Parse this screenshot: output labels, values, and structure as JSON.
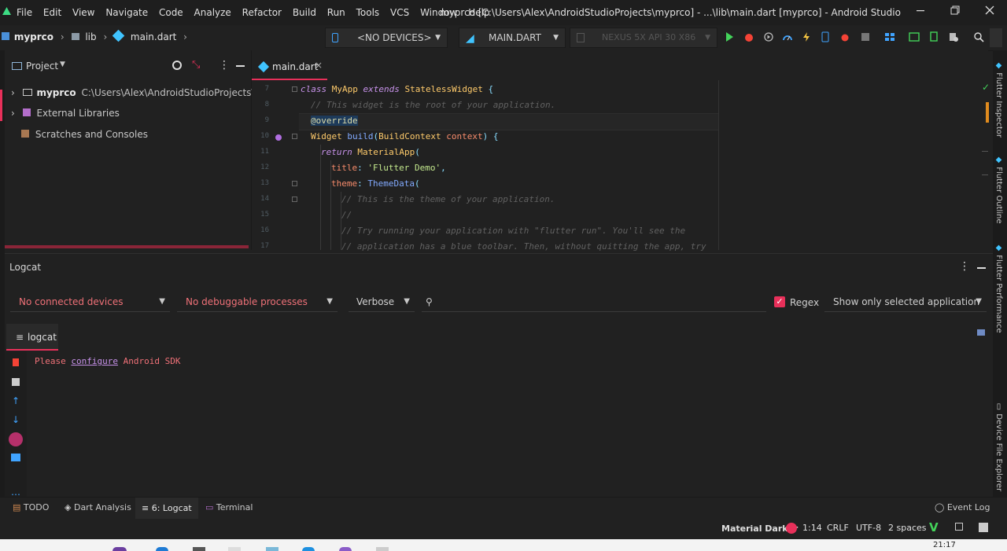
{
  "menu": [
    "File",
    "Edit",
    "View",
    "Navigate",
    "Code",
    "Analyze",
    "Refactor",
    "Build",
    "Run",
    "Tools",
    "VCS",
    "Window",
    "Help"
  ],
  "window_title": "myprco [C:\\Users\\Alex\\AndroidStudioProjects\\myprco] - ...\\lib\\main.dart [myprco] - Android Studio",
  "breadcrumb": {
    "project": "myprco",
    "folder": "lib",
    "file": "main.dart"
  },
  "toolbar": {
    "devices": "<NO DEVICES>",
    "run_config": "MAIN.DART",
    "emulator": "NEXUS 5X API 30 X86"
  },
  "project_panel": {
    "title": "Project",
    "root_name": "myprco",
    "root_path": "C:\\Users\\Alex\\AndroidStudioProjects\\myprco",
    "items": [
      "External Libraries",
      "Scratches and Consoles"
    ]
  },
  "editor": {
    "tab": "main.dart",
    "lines": [
      {
        "n": "7"
      },
      {
        "n": "8"
      },
      {
        "n": "9"
      },
      {
        "n": "10"
      },
      {
        "n": "11"
      },
      {
        "n": "12"
      },
      {
        "n": "13"
      },
      {
        "n": "14"
      },
      {
        "n": "15"
      },
      {
        "n": "16"
      },
      {
        "n": "17"
      }
    ],
    "code": {
      "l7a": "class",
      "l7b": "MyApp",
      "l7c": "extends",
      "l7d": "StatelessWidget",
      "l7e": "{",
      "l8": "// This widget is the root of your application.",
      "l9": "@override",
      "l10a": "Widget",
      "l10b": "build",
      "l10c": "(",
      "l10d": "BuildContext",
      "l10e": "context",
      "l10f": ") {",
      "l11a": "return",
      "l11b": "MaterialApp",
      "l11c": "(",
      "l12a": "title",
      "l12b": ":",
      "l12c": "'Flutter Demo'",
      "l12d": ",",
      "l13a": "theme",
      "l13b": ":",
      "l13c": "ThemeData",
      "l13d": "(",
      "l14": "// This is the theme of your application.",
      "l15": "//",
      "l16": "// Try running your application with \"flutter run\". You'll see the",
      "l17": "// application has a blue toolbar. Then, without quitting the app, try"
    }
  },
  "logcat": {
    "title": "Logcat",
    "device": "No connected devices",
    "process": "No debuggable processes",
    "level": "Verbose",
    "search_placeholder": "",
    "regex": "Regex",
    "filter": "Show only selected application",
    "tab": "logcat",
    "msg_a": "Please",
    "msg_link": "configure",
    "msg_b": "Android SDK"
  },
  "right_tools": [
    "Flutter Inspector",
    "Flutter Outline",
    "Flutter Performance",
    "Device File Explorer"
  ],
  "bottom_tools": {
    "todo": "TODO",
    "dart": "Dart Analysis",
    "logcat": "6: Logcat",
    "terminal": "Terminal",
    "event_log": "Event Log"
  },
  "status": {
    "theme": "Material Darker",
    "position": "1:14",
    "line_sep": "CRLF",
    "encoding": "UTF-8",
    "indent": "2 spaces"
  },
  "clock": "21:17",
  "colors": {
    "accent": "#e8305a",
    "keyword": "#c792ea",
    "string": "#c3e88d",
    "type": "#ffcb6b",
    "func": "#82aaff",
    "comment": "#616161",
    "error": "#f07178",
    "run": "#43d35a",
    "debug": "#f44336"
  }
}
